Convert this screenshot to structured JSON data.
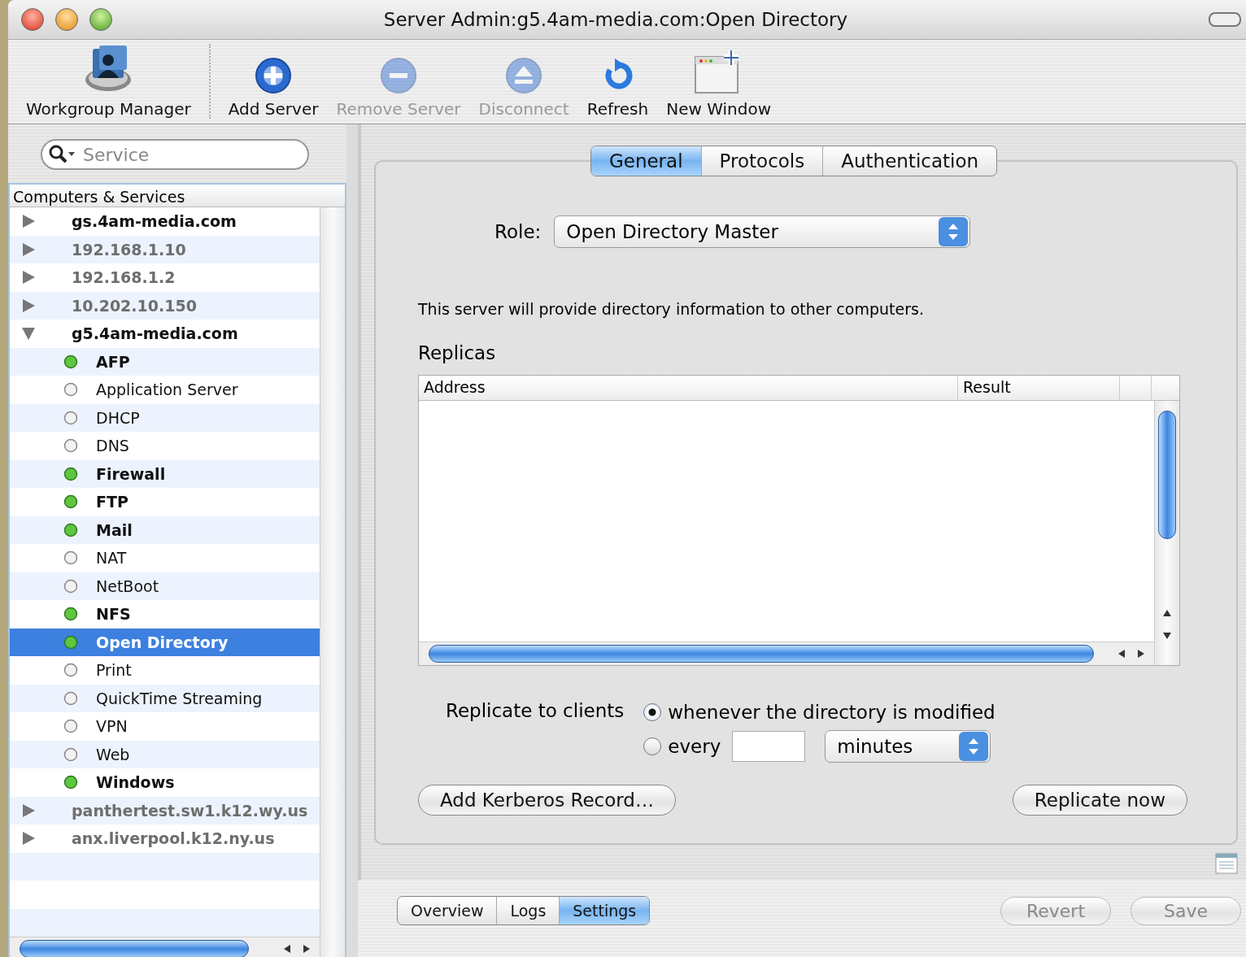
{
  "window": {
    "title": "Server Admin:g5.4am-media.com:Open Directory"
  },
  "toolbar": [
    {
      "label": "Workgroup Manager",
      "kind": "workgroup",
      "disabled": false
    },
    {
      "label": "Add Server",
      "kind": "add",
      "disabled": false
    },
    {
      "label": "Remove Server",
      "kind": "remove",
      "disabled": true
    },
    {
      "label": "Disconnect",
      "kind": "disconnect",
      "disabled": true
    },
    {
      "label": "Refresh",
      "kind": "refresh",
      "disabled": false
    },
    {
      "label": "New Window",
      "kind": "new_window",
      "disabled": false
    }
  ],
  "search": {
    "placeholder": "Service"
  },
  "sidebar": {
    "header": "Computers & Services",
    "servers": [
      {
        "name": "gs.4am-media.com",
        "connected": true,
        "expanded": false,
        "selected": false
      },
      {
        "name": "192.168.1.10",
        "connected": false,
        "expanded": false,
        "selected": false
      },
      {
        "name": "192.168.1.2",
        "connected": false,
        "expanded": false,
        "selected": false
      },
      {
        "name": "10.202.10.150",
        "connected": false,
        "expanded": false,
        "selected": false
      },
      {
        "name": "g5.4am-media.com",
        "connected": true,
        "expanded": true,
        "selected": false,
        "children": [
          {
            "name": "AFP",
            "running": true,
            "selected": false
          },
          {
            "name": "Application Server",
            "running": false,
            "selected": false
          },
          {
            "name": "DHCP",
            "running": false,
            "selected": false
          },
          {
            "name": "DNS",
            "running": false,
            "selected": false
          },
          {
            "name": "Firewall",
            "running": true,
            "selected": false
          },
          {
            "name": "FTP",
            "running": true,
            "selected": false
          },
          {
            "name": "Mail",
            "running": true,
            "selected": false
          },
          {
            "name": "NAT",
            "running": false,
            "selected": false
          },
          {
            "name": "NetBoot",
            "running": false,
            "selected": false
          },
          {
            "name": "NFS",
            "running": true,
            "selected": false
          },
          {
            "name": "Open Directory",
            "running": true,
            "selected": true
          },
          {
            "name": "Print",
            "running": false,
            "selected": false
          },
          {
            "name": "QuickTime Streaming",
            "running": false,
            "selected": false
          },
          {
            "name": "VPN",
            "running": false,
            "selected": false
          },
          {
            "name": "Web",
            "running": false,
            "selected": false
          },
          {
            "name": "Windows",
            "running": true,
            "selected": false
          }
        ]
      },
      {
        "name": "panthertest.sw1.k12.wy.us",
        "connected": false,
        "expanded": false,
        "selected": false
      },
      {
        "name": "anx.liverpool.k12.ny.us",
        "connected": false,
        "expanded": false,
        "selected": false
      }
    ]
  },
  "tabs": [
    {
      "label": "General",
      "selected": true
    },
    {
      "label": "Protocols",
      "selected": false
    },
    {
      "label": "Authentication",
      "selected": false
    }
  ],
  "role": {
    "label": "Role:",
    "value": "Open Directory Master"
  },
  "description": "This server will provide directory information to other computers.",
  "replicas": {
    "title": "Replicas",
    "columns": [
      "Address",
      "Result"
    ]
  },
  "replicate": {
    "label": "Replicate to clients",
    "options": [
      {
        "label": "whenever the directory is modified",
        "kind": "plain",
        "selected": true
      },
      {
        "label": "every",
        "kind": "interval",
        "selected": false
      }
    ],
    "unit": "minutes"
  },
  "buttons": [
    "Add Kerberos Record…",
    "Replicate now"
  ],
  "bottom_tabs": [
    {
      "label": "Overview",
      "selected": false
    },
    {
      "label": "Logs",
      "selected": false
    },
    {
      "label": "Settings",
      "selected": true
    }
  ],
  "actions": [
    {
      "label": "Revert",
      "disabled": true
    },
    {
      "label": "Save",
      "disabled": true
    }
  ]
}
